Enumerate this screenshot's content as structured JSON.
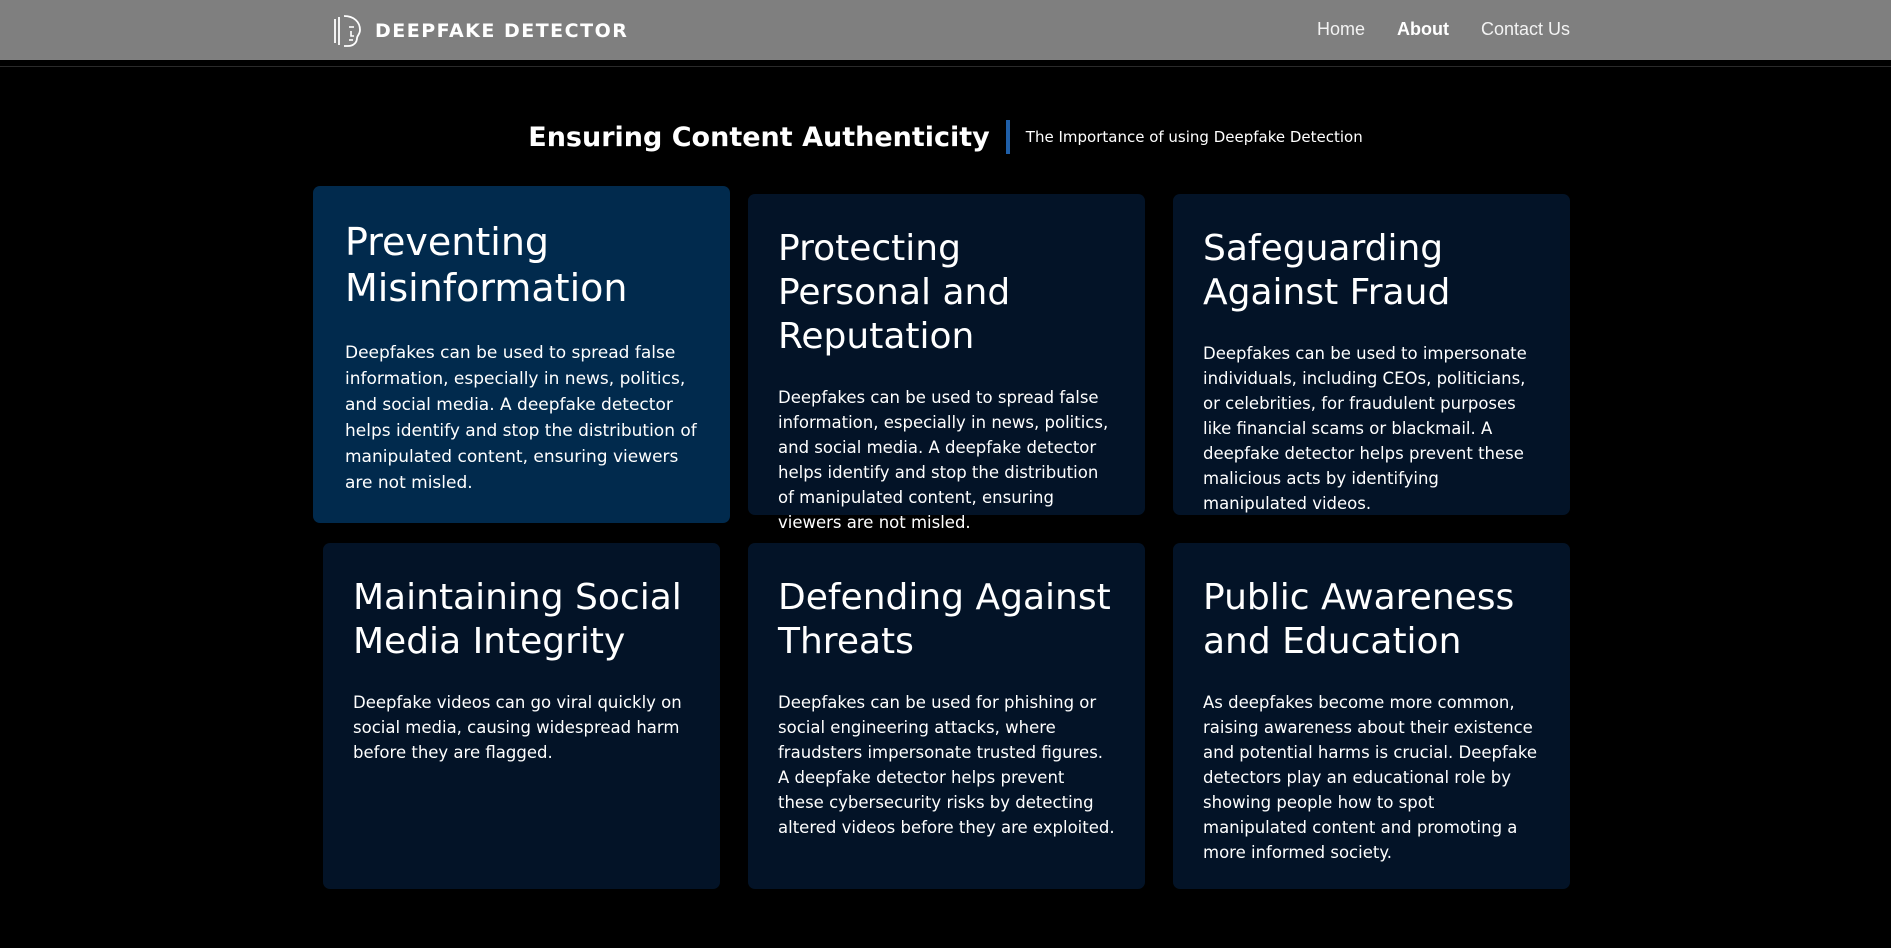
{
  "navbar": {
    "logo_text": "DEEPFAKE DETECTOR",
    "logo_icon": "face-outline-icon",
    "links": [
      {
        "label": "Home",
        "active": false
      },
      {
        "label": "About",
        "active": true
      },
      {
        "label": "Contact Us",
        "active": false
      }
    ],
    "background_color": "#7f7f7f"
  },
  "section": {
    "title": "Ensuring Content Authenticity",
    "subtitle": "The Importance of using Deepfake Detection",
    "accent_color": "#1f5fa8"
  },
  "cards": [
    {
      "title": "Preventing Misinformation",
      "body": "Deepfakes can be used to spread false information, especially in news, politics, and social media. A deepfake detector helps identify and stop the distribution of manipulated content, ensuring viewers are not misled."
    },
    {
      "title": "Protecting Personal and Reputation",
      "body": "Deepfakes can be used to spread false information, especially in news, politics, and social media. A deepfake detector helps identify and stop the distribution of manipulated content, ensuring viewers are not misled."
    },
    {
      "title": "Safeguarding Against Fraud",
      "body": "Deepfakes can be used to impersonate individuals, including CEOs, politicians, or celebrities, for fraudulent purposes like financial scams or blackmail. A deepfake detector helps prevent these malicious acts by identifying manipulated videos."
    },
    {
      "title": "Maintaining Social Media Integrity",
      "body": "Deepfake videos can go viral quickly on social media, causing widespread harm before they are flagged."
    },
    {
      "title": "Defending Against Threats",
      "body": "Deepfakes can be used for phishing or social engineering attacks, where fraudsters impersonate trusted figures. A deepfake detector helps prevent these cybersecurity risks by detecting altered videos before they are exploited."
    },
    {
      "title": "Public Awareness and Education",
      "body": "As deepfakes become more common, raising awareness about their existence and potential harms is crucial. Deepfake detectors play an educational role by showing people how to spot manipulated content and promoting a more informed society."
    }
  ],
  "colors": {
    "page_background": "#000000",
    "card_background": "#031327",
    "card_featured_background": "#012a4d"
  }
}
